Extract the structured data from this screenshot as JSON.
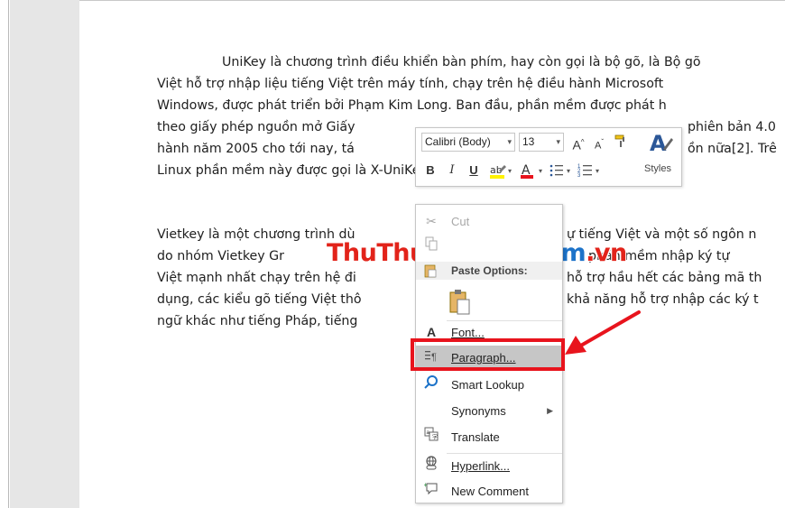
{
  "document": {
    "para1": [
      "UniKey là chương trình điều khiển bàn phím, hay còn gọi là bộ gõ, là Bộ gõ",
      "Việt hỗ trợ nhập liệu tiếng Việt trên máy tính, chạy trên hệ điều hành Microsoft",
      "Windows, được phát triển bởi Phạm Kim Long. Ban đầu, phần mềm được phát h",
      "theo giấy phép nguồn mở Giấy",
      "hành năm 2005 cho tới nay, tá",
      "Linux phần mềm này được gọi là X-UniKey."
    ],
    "para1_tail": [
      "",
      "",
      "",
      "phiên bản 4.0",
      "ồn nữa[2]. Trê",
      ""
    ],
    "para2": [
      "Vietkey là một chương trình dù",
      "do nhóm Vietkey Gr",
      "Việt mạnh nhất chạy trên hệ đi",
      "dụng, các kiểu gõ tiếng Việt thô",
      "ngữ khác như tiếng Pháp, tiếng"
    ],
    "para2_tail": [
      "ự tiếng Việt và một số ngôn n",
      "phần mềm nhập ký tự",
      "hỗ trợ hầu hết các bảng mã th",
      "khả năng hỗ trợ nhập các ký t",
      ""
    ]
  },
  "watermark": {
    "part1": "Thu",
    "part2": "Thuat",
    "part3": "PhanMem",
    "part4": ".vn"
  },
  "mini_toolbar": {
    "font_name": "Calibri (Body)",
    "font_size": "13",
    "grow_font": "A",
    "shrink_font": "A",
    "bold": "B",
    "italic": "I",
    "underline": "U",
    "font_color": "A",
    "styles_label": "Styles"
  },
  "context_menu": {
    "cut": "Cut",
    "paste_options": "Paste Options:",
    "font": "Font...",
    "paragraph": "Paragraph...",
    "smart_lookup": "Smart Lookup",
    "synonyms": "Synonyms",
    "translate": "Translate",
    "hyperlink": "Hyperlink...",
    "new_comment": "New Comment"
  },
  "colors": {
    "highlight_red": "#e8141d",
    "watermark_red": "#e2231a",
    "watermark_blue": "#1d73c9",
    "margin_gray": "#e6e6e6"
  }
}
